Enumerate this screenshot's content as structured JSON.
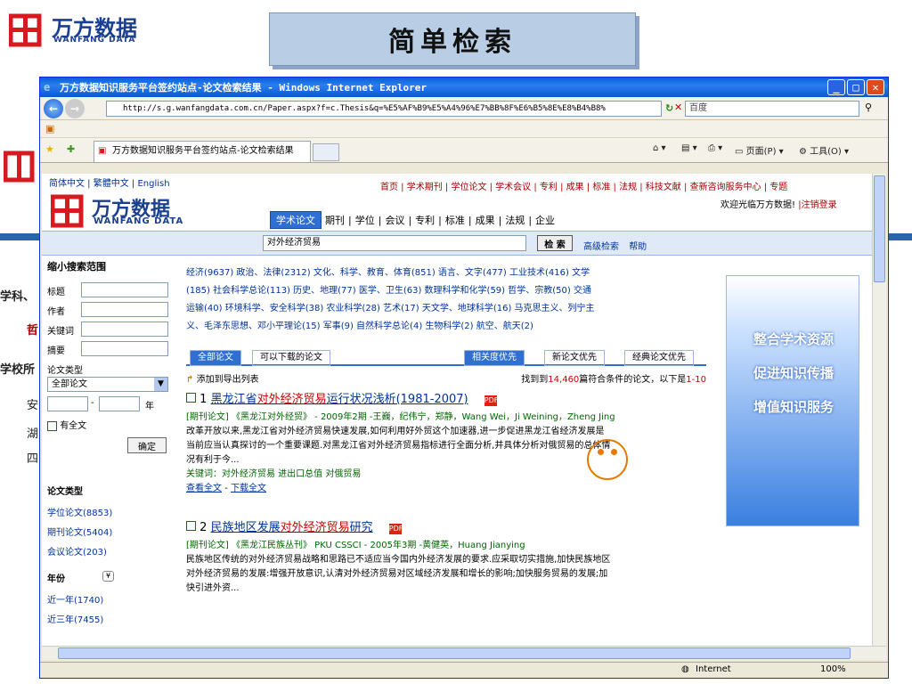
{
  "slide": {
    "logo_cn": "万方数据",
    "logo_en": "WANFANG DATA",
    "title": "简单检索",
    "left_frag_1": "学科、",
    "left_frag_2": "哲",
    "left_frag_3": "学校所",
    "left_frag_4": "安",
    "left_frag_5": "湖",
    "left_frag_6": "四"
  },
  "window": {
    "title": "万方数据知识服务平台签约站点-论文检索结果 - Windows Internet Explorer",
    "address": "http://s.g.wanfangdata.com.cn/Paper.aspx?f=c.Thesis&q=%E5%AF%B9%E5%A4%96%E7%BB%8F%E6%B5%8E%E8%B4%B8%",
    "search_placeholder": "百度",
    "tab_label": "万方数据知识服务平台签约站点-论文检索结果",
    "tools": [
      "页面(P)",
      "工具(O)"
    ],
    "status": "Internet",
    "zoom": "100%"
  },
  "page": {
    "langs": "简体中文 | 繁體中文 | English",
    "topnav": "首页 | 学术期刊 | 学位论文 | 学术会议 | 专利 | 成果 | 标准 | 法规 | 科技文献 | 查新咨询服务中心 | 专题",
    "welcome": "欢迎光临万方数据!",
    "logout": "|注销登录",
    "mainnav": [
      "学术论文",
      "期刊",
      "|",
      "学位",
      "|",
      "会议",
      "|",
      "专利",
      "|",
      "标准",
      "|",
      "成果",
      "|",
      "法规",
      "|",
      "企业"
    ],
    "query": "对外经济贸易",
    "search_button": "检 索",
    "advanced": "高级检索",
    "help": "帮助",
    "left": {
      "scope": "缩小搜索范围",
      "fields": [
        "标题",
        "作者",
        "关键词",
        "摘要"
      ],
      "type_label": "论文类型",
      "type_value": "全部论文",
      "year_sep": "-",
      "year_unit": "年",
      "fulltext": "有全文",
      "confirm": "确定",
      "facet_type_title": "论文类型",
      "facet_types": [
        "学位论文(8853)",
        "期刊论文(5404)",
        "会议论文(203)"
      ],
      "facet_year_title": "年份",
      "facet_years": [
        "近一年(1740)",
        "近三年(7455)"
      ]
    },
    "categories": [
      "经济(9637)  政治、法律(2312)  文化、科学、教育、体育(851)  语言、文字(477)  工业技术(416)  文学",
      "(185)  社会科学总论(113)  历史、地理(77)  医学、卫生(63)  数理科学和化学(59)  哲学、宗教(50)  交通",
      "运输(40)  环境科学、安全科学(38)  农业科学(28)  艺术(17)  天文学、地球科学(16)  马克思主义、列宁主",
      "义、毛泽东思想、邓小平理论(15)  军事(9)  自然科学总论(4)  生物科学(2)  航空、航天(2)"
    ],
    "tabs": [
      "全部论文",
      "可以下载的论文",
      "相关度优先",
      "新论文优先",
      "经典论文优先"
    ],
    "export": "添加到导出列表",
    "found_prefix": "找到到",
    "found_count": "14,460",
    "found_suffix": "篇符合条件的论文，以下是",
    "found_range": "1-10",
    "results": [
      {
        "num": "1",
        "title_a": "黑龙江省",
        "title_hl": "对外经济贸易",
        "title_b": "运行状况浅析(1981-2007)",
        "meta": "[期刊论文] 《黑龙江对外经贸》 - 2009年2期 -王巍，纪伟宁，郑静，Wang Wei，Ji Weining，Zheng Jing",
        "abs1": "改革开放以来,黑龙江省对外经济贸易快速发展,如何利用好外贸这个加速器,进一步促进黑龙江省经济发展是",
        "abs2": "当前应当认真探讨的一个重要课题.对黑龙江省对外经济贸易指标进行全面分析,并具体分析对俄贸易的总体情",
        "abs3": "况有利于今...",
        "keywords": "关键词：对外经济贸易  进出口总值  对俄贸易",
        "view": "查看全文",
        "sep": "-",
        "download": "下载全文"
      },
      {
        "num": "2",
        "title_a": "民族地区发展",
        "title_hl": "对外经济贸易",
        "title_b": "研究",
        "meta": "[期刊论文] 《黑龙江民族丛刊》 PKU CSSCI - 2005年3期 -黄健英，Huang Jianying",
        "abs1": "民族地区传统的对外经济贸易战略和思路已不适应当今国内外经济发展的要求.应采取切实措施,加快民族地区",
        "abs2": "对外经济贸易的发展:增强开放意识,认清对外经济贸易对区域经济发展和增长的影响;加快服务贸易的发展;加",
        "abs3": "快引进外资..."
      }
    ],
    "ad": [
      "整合学术资源",
      "促进知识传播",
      "增值知识服务"
    ]
  }
}
